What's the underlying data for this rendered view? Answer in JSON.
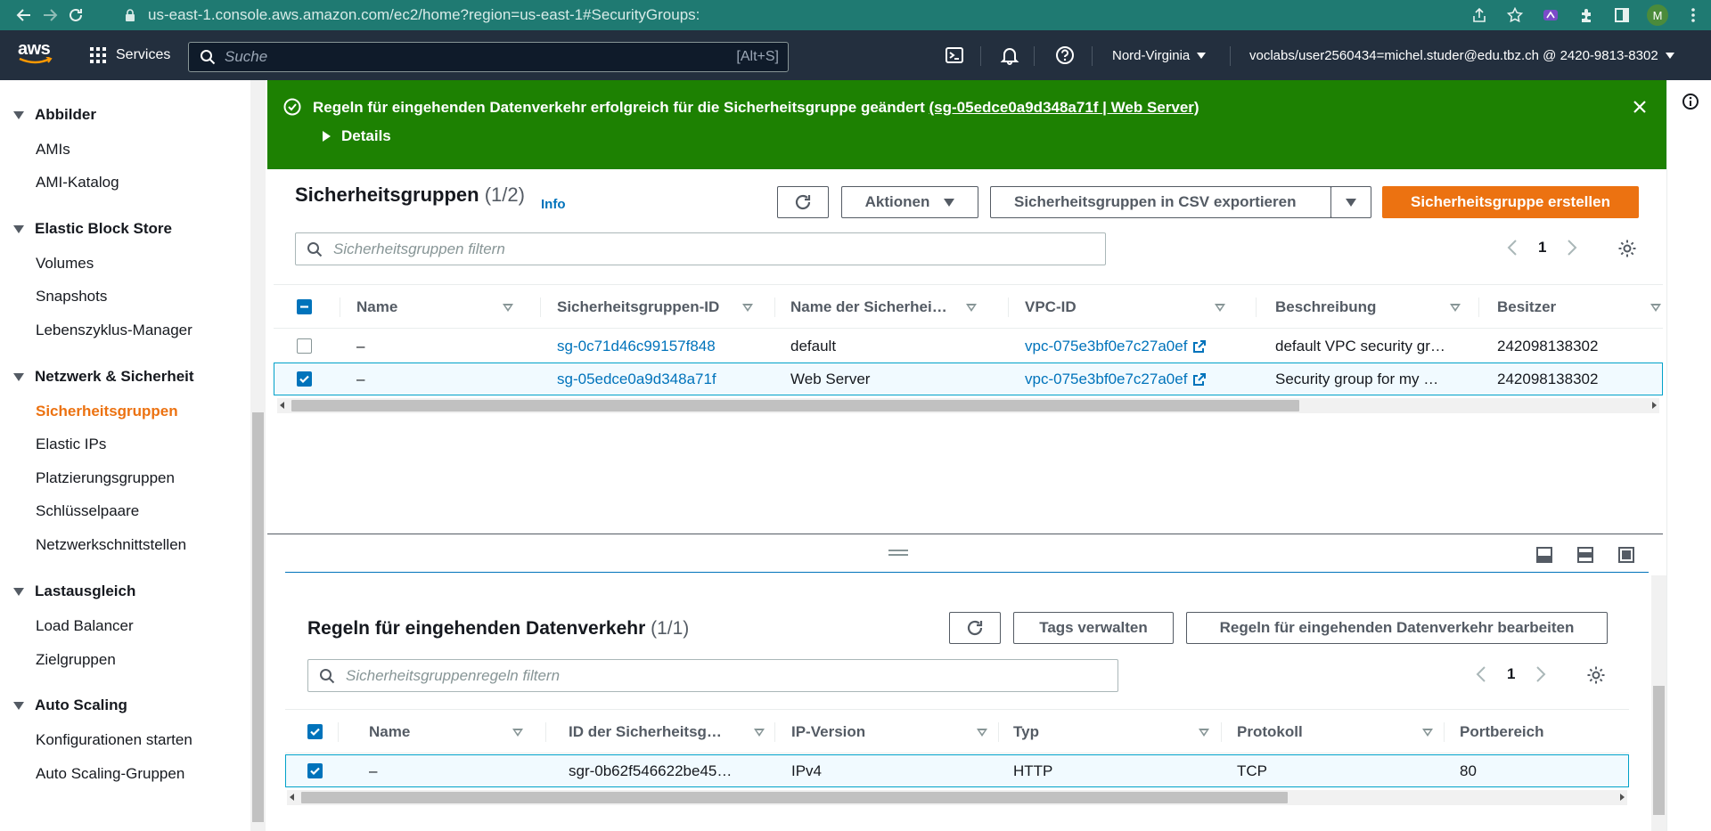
{
  "browser": {
    "url": "us-east-1.console.aws.amazon.com/ec2/home?region=us-east-1#SecurityGroups:",
    "profile_initial": "M"
  },
  "topbar": {
    "logo_text": "aws",
    "services_label": "Services",
    "search_placeholder": "Suche",
    "search_shortcut": "[Alt+S]",
    "region_label": "Nord-Virginia",
    "account_label": "voclabs/user2560434=michel.studer@edu.tbz.ch @ 2420-9813-8302"
  },
  "sidebar": {
    "sections": [
      {
        "title": "Abbilder",
        "items": [
          "AMIs",
          "AMI-Katalog"
        ]
      },
      {
        "title": "Elastic Block Store",
        "items": [
          "Volumes",
          "Snapshots",
          "Lebenszyklus-Manager"
        ]
      },
      {
        "title": "Netzwerk & Sicherheit",
        "items": [
          "Sicherheitsgruppen",
          "Elastic IPs",
          "Platzierungsgruppen",
          "Schlüsselpaare",
          "Netzwerkschnittstellen"
        ]
      },
      {
        "title": "Lastausgleich",
        "items": [
          "Load Balancer",
          "Zielgruppen"
        ]
      },
      {
        "title": "Auto Scaling",
        "items": [
          "Konfigurationen starten",
          "Auto Scaling-Gruppen"
        ]
      }
    ],
    "active_item": "Sicherheitsgruppen"
  },
  "flash": {
    "message": "Regeln für eingehenden Datenverkehr erfolgreich für die Sicherheitsgruppe geändert",
    "link_text": "(sg-05edce0a9d348a71f | Web Server)",
    "details_label": "Details"
  },
  "security_groups": {
    "title": "Sicherheitsgruppen",
    "count": "(1/2)",
    "info_label": "Info",
    "actions_label": "Aktionen",
    "export_label": "Sicherheitsgruppen in CSV exportieren",
    "create_label": "Sicherheitsgruppe erstellen",
    "filter_placeholder": "Sicherheitsgruppen filtern",
    "page": "1",
    "columns": [
      "Name",
      "Sicherheitsgruppen-ID",
      "Name der Sicherhei…",
      "VPC-ID",
      "Beschreibung",
      "Besitzer"
    ],
    "rows": [
      {
        "selected": false,
        "name": "–",
        "id": "sg-0c71d46c99157f848",
        "group_name": "default",
        "vpc": "vpc-075e3bf0e7c27a0ef",
        "description": "default VPC security gr…",
        "owner": "242098138302"
      },
      {
        "selected": true,
        "name": "–",
        "id": "sg-05edce0a9d348a71f",
        "group_name": "Web Server",
        "vpc": "vpc-075e3bf0e7c27a0ef",
        "description": "Security group for my …",
        "owner": "242098138302"
      }
    ]
  },
  "inbound_rules": {
    "title": "Regeln für eingehenden Datenverkehr",
    "count": "(1/1)",
    "manage_tags_label": "Tags verwalten",
    "edit_label": "Regeln für eingehenden Datenverkehr bearbeiten",
    "filter_placeholder": "Sicherheitsgruppenregeln filtern",
    "page": "1",
    "columns": [
      "Name",
      "ID der Sicherheitsg…",
      "IP-Version",
      "Typ",
      "Protokoll",
      "Portbereich"
    ],
    "rows": [
      {
        "selected": true,
        "name": "–",
        "rule_id": "sgr-0b62f546622be45…",
        "ip_version": "IPv4",
        "type": "HTTP",
        "protocol": "TCP",
        "port_range": "80"
      }
    ]
  },
  "colors": {
    "chrome": "#1f7a72",
    "aws_header": "#232f3e",
    "success": "#1d8102",
    "primary": "#ec7211",
    "link": "#0073bb"
  }
}
